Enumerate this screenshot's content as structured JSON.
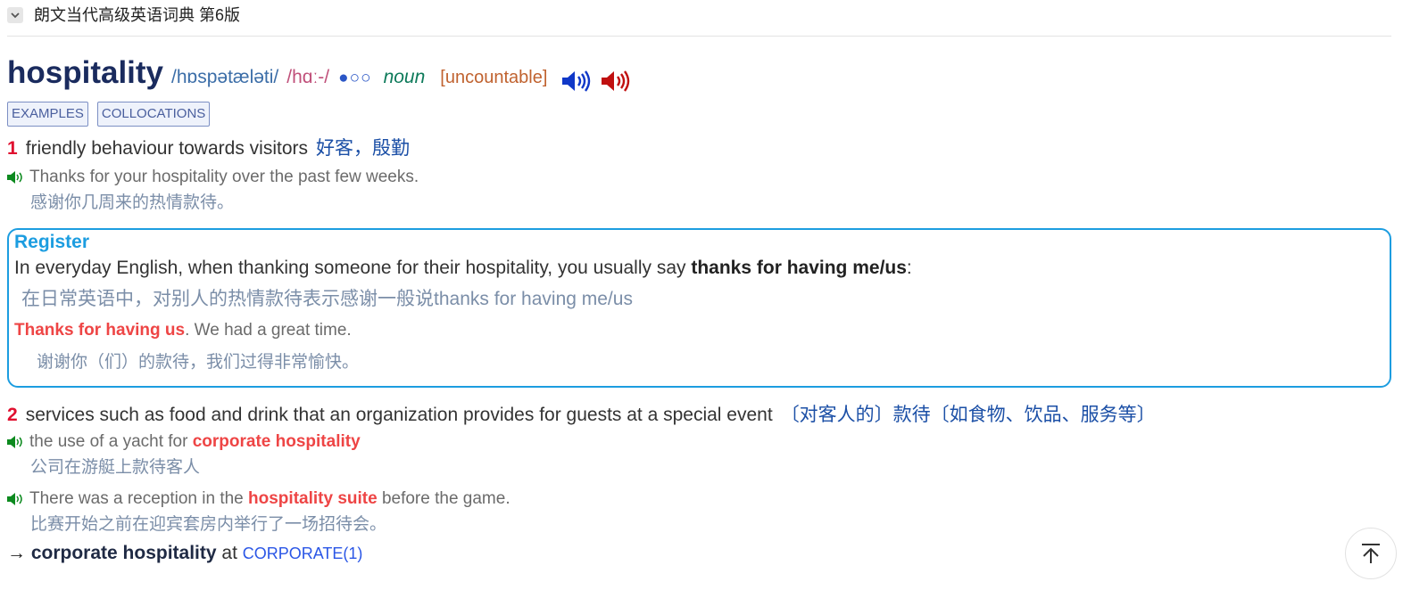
{
  "header": {
    "title": "朗文当代高级英语词典 第6版",
    "collapse_icon": "chevron-down-icon"
  },
  "entry": {
    "headword": "hospitality",
    "pron_br": "/hɒspətæləti/",
    "pron_am": "/hɑː-/",
    "frequency": "●○○",
    "pos": "noun",
    "grammar": "[uncountable]",
    "audio_br_icon": "speaker-blue-icon",
    "audio_am_icon": "speaker-red-icon",
    "tabs": [
      "EXAMPLES",
      "COLLOCATIONS"
    ],
    "senses": [
      {
        "num": "1",
        "definition": "friendly behaviour towards visitors",
        "translation": "好客，殷勤",
        "examples": [
          {
            "text": "Thanks for your hospitality over the past few weeks.",
            "translation": "感谢你几周来的热情款待。"
          }
        ]
      },
      {
        "num": "2",
        "definition": "services such as food and drink that an organization provides for guests at a special event",
        "translation": "〔对客人的〕款待〔如食物、饮品、服务等〕",
        "examples": [
          {
            "before": "the use of a yacht for ",
            "highlight": "corporate hospitality",
            "after": "",
            "translation": "公司在游艇上款待客人"
          },
          {
            "before": "There was a reception in the ",
            "highlight": "hospitality suite",
            "after": " before the game.",
            "translation": "比赛开始之前在迎宾套房内举行了一场招待会。"
          }
        ]
      }
    ],
    "register_note": {
      "title": "Register",
      "body_before": "In everyday English, when thanking someone for their hospitality, you usually say ",
      "body_bold": "thanks for having me/us",
      "body_after": ":",
      "body_translation": "在日常英语中，对别人的热情款待表示感谢一般说thanks for having me/us",
      "example_highlight": "Thanks for having us",
      "example_rest": ". We had a great time.",
      "example_translation": "谢谢你（们）的款待，我们过得非常愉快。"
    },
    "cross_ref": {
      "arrow": "→",
      "phrase": "corporate hospitality",
      "at": "at",
      "link": "CORPORATE(1)"
    }
  },
  "back_to_top_icon": "arrow-up-to-top-icon",
  "colors": {
    "headword": "#1a2b5e",
    "sense_number": "#e0102f",
    "highlight": "#ee4545",
    "note_border": "#1c9de0",
    "translation": "#7b8ea8",
    "link": "#2a56e6"
  }
}
